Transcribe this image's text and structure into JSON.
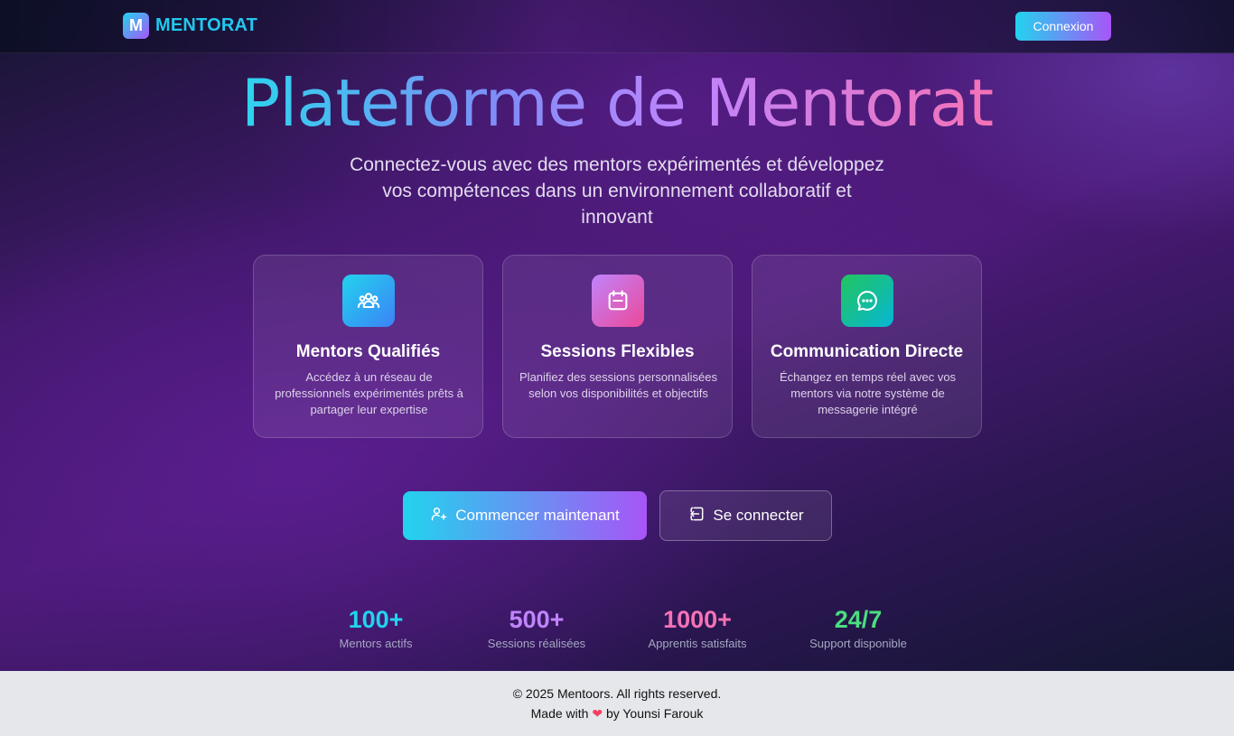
{
  "header": {
    "logo_letter": "M",
    "brand": "MENTORAT",
    "login_label": "Connexion"
  },
  "hero": {
    "title": "Plateforme de Mentorat",
    "subtitle": "Connectez-vous avec des mentors expérimentés et développez vos compétences dans un environnement collaboratif et innovant"
  },
  "features": [
    {
      "icon": "users-icon",
      "title": "Mentors Qualifiés",
      "description": "Accédez à un réseau de professionnels expérimentés prêts à partager leur expertise",
      "gradient": [
        "#22d3ee",
        "#3b82f6"
      ]
    },
    {
      "icon": "calendar-icon",
      "title": "Sessions Flexibles",
      "description": "Planifiez des sessions personnalisées selon vos disponibilités et objectifs",
      "gradient": [
        "#c084fc",
        "#ec4899"
      ]
    },
    {
      "icon": "chat-icon",
      "title": "Communication Directe",
      "description": "Échangez en temps réel avec vos mentors via notre système de messagerie intégré",
      "gradient": [
        "#22c55e",
        "#06b6d4"
      ]
    }
  ],
  "cta": {
    "primary_label": "Commencer maintenant",
    "secondary_label": "Se connecter"
  },
  "stats": [
    {
      "value": "100+",
      "label": "Mentors actifs",
      "color": "#22d3ee"
    },
    {
      "value": "500+",
      "label": "Sessions réalisées",
      "color": "#c084fc"
    },
    {
      "value": "1000+",
      "label": "Apprentis satisfaits",
      "color": "#f472b6"
    },
    {
      "value": "24/7",
      "label": "Support disponible",
      "color": "#4ade80"
    }
  ],
  "footer": {
    "copyright": "© 2025 Mentoors. All rights reserved.",
    "made_with": "Made with",
    "heart": "❤",
    "author": "by Younsi Farouk"
  }
}
